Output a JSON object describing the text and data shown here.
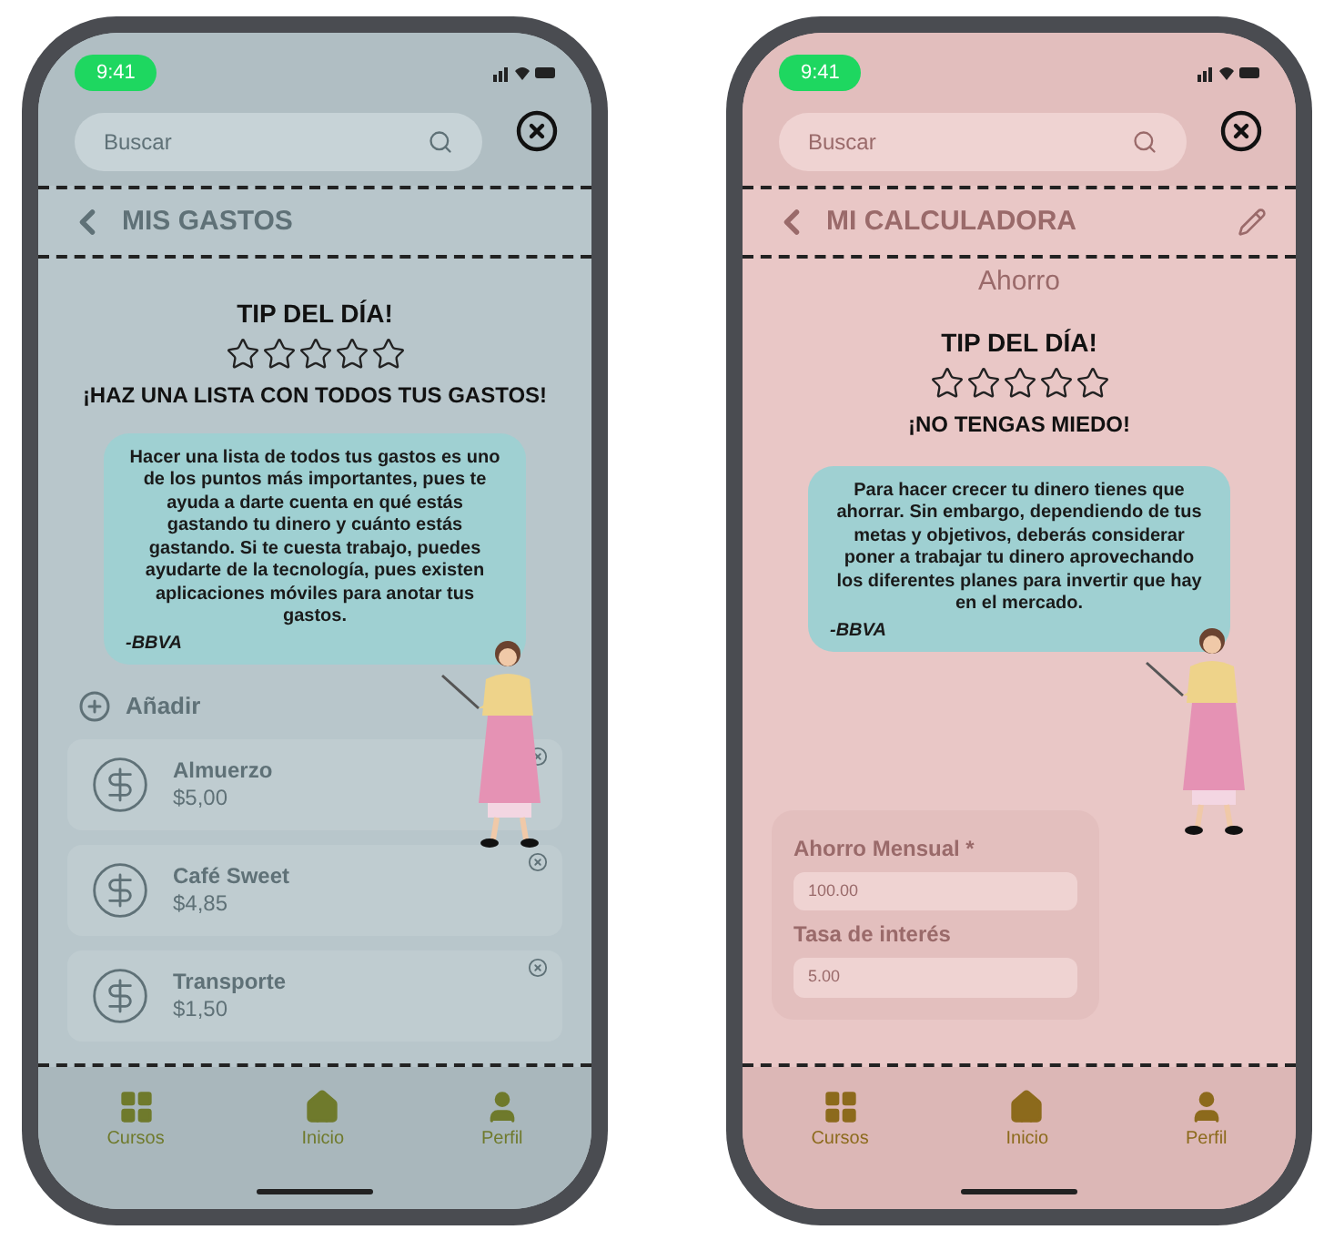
{
  "phones": [
    {
      "kind": "expenses",
      "status_time": "9:41",
      "search": {
        "placeholder": "Buscar"
      },
      "header": "MIS GASTOS",
      "add_label": "Añadir",
      "expenses": [
        {
          "name": "Almuerzo",
          "amount": "$5,00"
        },
        {
          "name": "Café Sweet",
          "amount": "$4,85"
        },
        {
          "name": "Transporte",
          "amount": "$1,50"
        }
      ],
      "tip": {
        "title": "TIP DEL DÍA!",
        "stars": 0,
        "headline": "¡HAZ UNA LISTA CON TODOS TUS GASTOS!",
        "body": "Hacer una lista de todos tus gastos es uno de los puntos más importantes, pues te ayuda a darte cuenta en qué estás gastando tu dinero y cuánto estás gastando. Si te cuesta trabajo, puedes ayudarte de la tecnología, pues existen aplicaciones móviles para anotar tus gastos.",
        "source": "-BBVA"
      },
      "nav": [
        {
          "label": "Cursos"
        },
        {
          "label": "Inicio"
        },
        {
          "label": "Perfil"
        }
      ]
    },
    {
      "kind": "calculator",
      "status_time": "9:41",
      "search": {
        "placeholder": "Buscar"
      },
      "header": "MI CALCULADORA",
      "section_title": "Ahorro",
      "fields": [
        {
          "label": "Ahorro Mensual *",
          "value": "100.00"
        },
        {
          "label": "Tasa de interés",
          "value": "5.00"
        }
      ],
      "tip": {
        "title": "TIP DEL DÍA!",
        "stars": 0,
        "headline": "¡NO TENGAS MIEDO!",
        "body": "Para hacer crecer tu dinero tienes que ahorrar. Sin embargo, dependiendo de tus metas y objetivos, deberás considerar poner a trabajar tu dinero aprovechando los diferentes planes para invertir que hay en el mercado.",
        "source": "-BBVA"
      },
      "nav": [
        {
          "label": "Cursos"
        },
        {
          "label": "Inicio"
        },
        {
          "label": "Perfil"
        }
      ]
    }
  ]
}
